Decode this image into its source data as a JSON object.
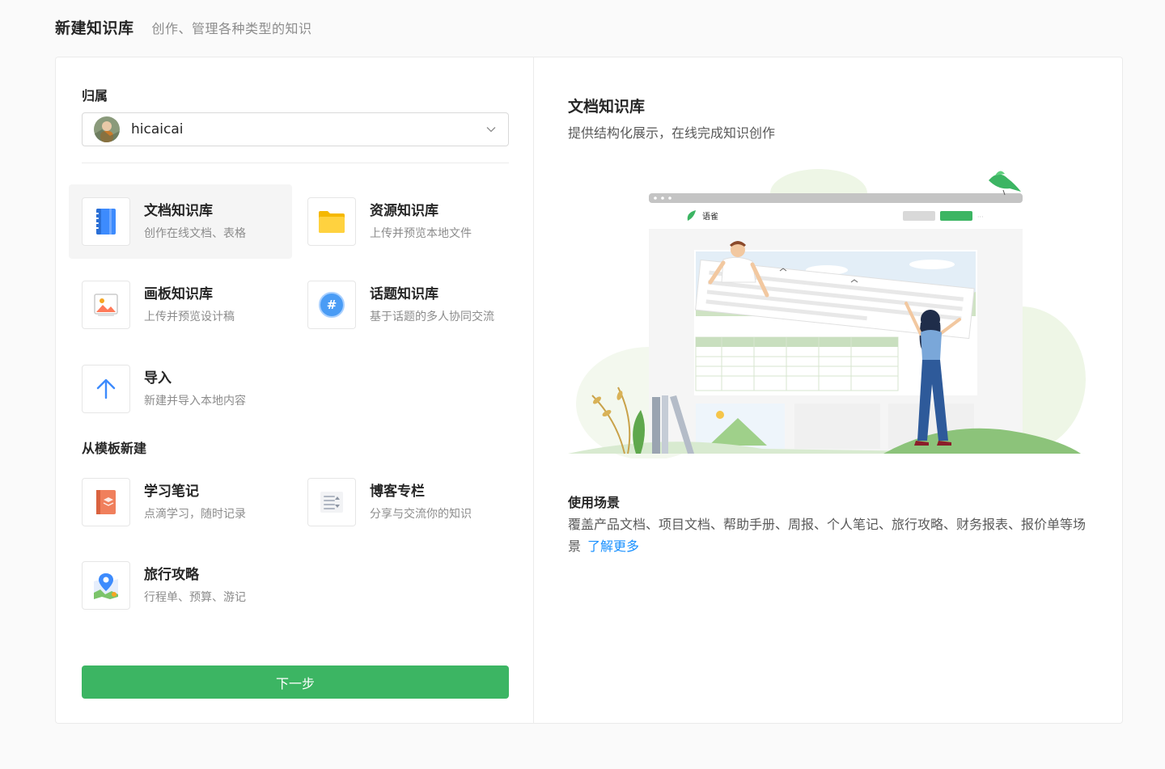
{
  "header": {
    "title": "新建知识库",
    "subtitle": "创作、管理各种类型的知识"
  },
  "left": {
    "owner_label": "归属",
    "owner_value": "hicaicai",
    "types": [
      {
        "title": "文档知识库",
        "desc": "创作在线文档、表格",
        "icon": "book-icon",
        "selected": true
      },
      {
        "title": "资源知识库",
        "desc": "上传并预览本地文件",
        "icon": "folder-icon"
      },
      {
        "title": "画板知识库",
        "desc": "上传并预览设计稿",
        "icon": "image-icon"
      },
      {
        "title": "话题知识库",
        "desc": "基于话题的多人协同交流",
        "icon": "hashtag-icon"
      },
      {
        "title": "导入",
        "desc": "新建并导入本地内容",
        "icon": "arrow-up-icon"
      }
    ],
    "template_label": "从模板新建",
    "templates": [
      {
        "title": "学习笔记",
        "desc": "点滴学习，随时记录",
        "icon": "notebook-icon"
      },
      {
        "title": "博客专栏",
        "desc": "分享与交流你的知识",
        "icon": "blog-icon"
      },
      {
        "title": "旅行攻略",
        "desc": "行程单、预算、游记",
        "icon": "map-pin-icon"
      }
    ],
    "next_button": "下一步"
  },
  "right": {
    "title": "文档知识库",
    "subtitle": "提供结构化展示，在线完成知识创作",
    "illustration_brand": "语雀",
    "usage_title": "使用场景",
    "usage_text": "覆盖产品文档、项目文档、帮助手册、周报、个人笔记、旅行攻略、财务报表、报价单等场景",
    "learn_more": "了解更多"
  },
  "colors": {
    "primary_green": "#3cb563",
    "link_blue": "#1890ff"
  }
}
